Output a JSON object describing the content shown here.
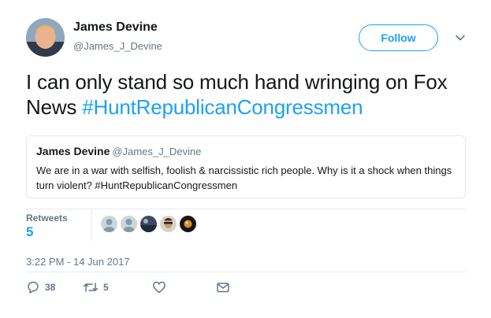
{
  "author": {
    "name": "James Devine",
    "handle": "@James_J_Devine",
    "avatar_icon": "profile-photo"
  },
  "follow_label": "Follow",
  "tweet": {
    "text": "I can only stand so much hand wringing on Fox News ",
    "hashtag": "#HuntRepublicanCongressmen"
  },
  "quoted_tweet": {
    "name": "James Devine",
    "handle": "@James_J_Devine",
    "text": "We are in a war with selfish, foolish & narcissistic rich people. Why is it a shock when things turn violent?  #HuntRepublicanCongressmen"
  },
  "stats": {
    "retweets_label": "Retweets",
    "retweets_count": "5"
  },
  "timestamp": "3:22 PM - 14 Jun 2017",
  "actions": {
    "replies": "38",
    "retweets": "5"
  },
  "colors": {
    "accent": "#1da1f2",
    "secondary_text": "#657786",
    "border": "#e1e8ed"
  }
}
